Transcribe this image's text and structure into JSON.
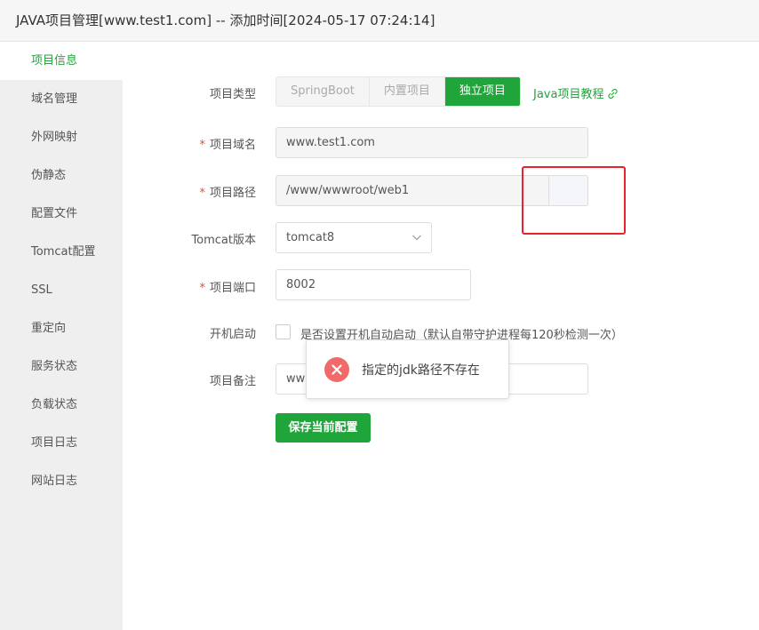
{
  "window": {
    "title": "JAVA项目管理[www.test1.com] -- 添加时间[2024-05-17 07:24:14]"
  },
  "sidebar": {
    "items": [
      {
        "label": "项目信息",
        "active": true
      },
      {
        "label": "域名管理"
      },
      {
        "label": "外网映射"
      },
      {
        "label": "伪静态"
      },
      {
        "label": "配置文件"
      },
      {
        "label": "Tomcat配置"
      },
      {
        "label": "SSL"
      },
      {
        "label": "重定向"
      },
      {
        "label": "服务状态"
      },
      {
        "label": "负载状态"
      },
      {
        "label": "项目日志"
      },
      {
        "label": "网站日志"
      }
    ]
  },
  "form": {
    "project_type": {
      "label": "项目类型",
      "options": [
        "SpringBoot",
        "内置项目",
        "独立项目"
      ],
      "selected": "独立项目"
    },
    "tutorial_link": "Java项目教程",
    "domain": {
      "label": "项目域名",
      "required": "*",
      "value": "www.test1.com"
    },
    "path": {
      "label": "项目路径",
      "required": "*",
      "value": "/www/wwwroot/web1"
    },
    "tomcat": {
      "label": "Tomcat版本",
      "value": "tomcat8"
    },
    "port": {
      "label": "项目端口",
      "required": "*",
      "value": "8002"
    },
    "autostart": {
      "label": "开机启动",
      "text": "是否设置开机自动启动（默认自带守护进程每120秒检测一次）",
      "checked": false
    },
    "remark": {
      "label": "项目备注",
      "value": "ww"
    },
    "save_button": "保存当前配置"
  },
  "toast": {
    "type": "error",
    "message": "指定的jdk路径不存在"
  },
  "colors": {
    "accent": "#20a53a",
    "error": "#f06a6a",
    "highlight_box": "#e8222e"
  }
}
